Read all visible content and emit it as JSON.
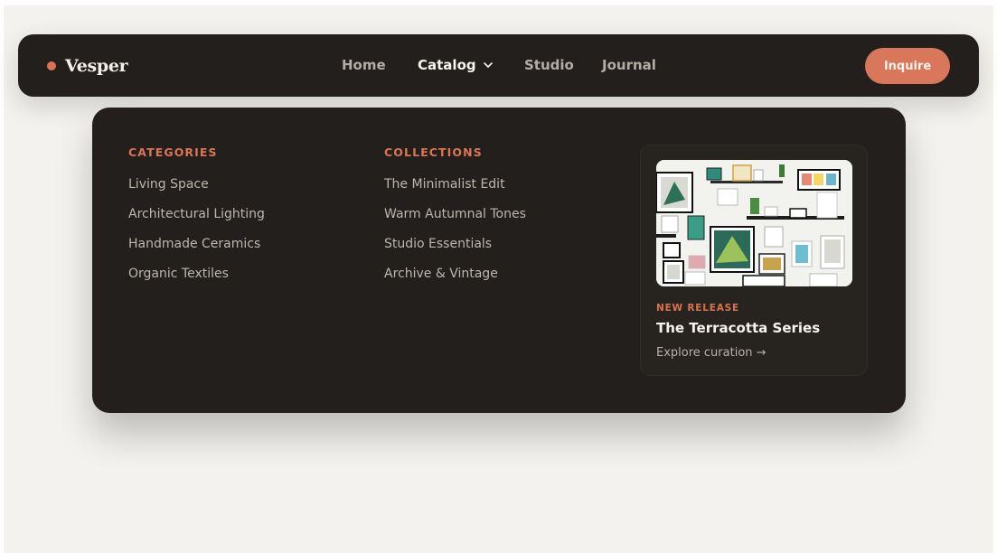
{
  "brand": {
    "name": "Vesper",
    "accent": "#dc7452"
  },
  "nav": {
    "items": [
      {
        "label": "Home"
      },
      {
        "label": "Catalog",
        "active": true,
        "icon": "chevron-down-icon"
      },
      {
        "label": "Studio"
      },
      {
        "label": "Journal"
      }
    ],
    "cta_label": "Inquire"
  },
  "menu": {
    "columns": [
      {
        "title": "CATEGORIES",
        "items": [
          "Living Space",
          "Architectural Lighting",
          "Handmade Ceramics",
          "Organic Textiles"
        ]
      },
      {
        "title": "COLLECTIONS",
        "items": [
          "The Minimalist Edit",
          "Warm Autumnal Tones",
          "Studio Essentials",
          "Archive & Vintage"
        ]
      }
    ],
    "feature": {
      "kicker": "NEW RELEASE",
      "title": "The Terracotta Series",
      "link": "Explore curation →",
      "image": "gallery-wall-photo"
    }
  },
  "colors": {
    "dark": "#221f1c",
    "accent": "#d9775a",
    "page": "#f3f2ee"
  }
}
